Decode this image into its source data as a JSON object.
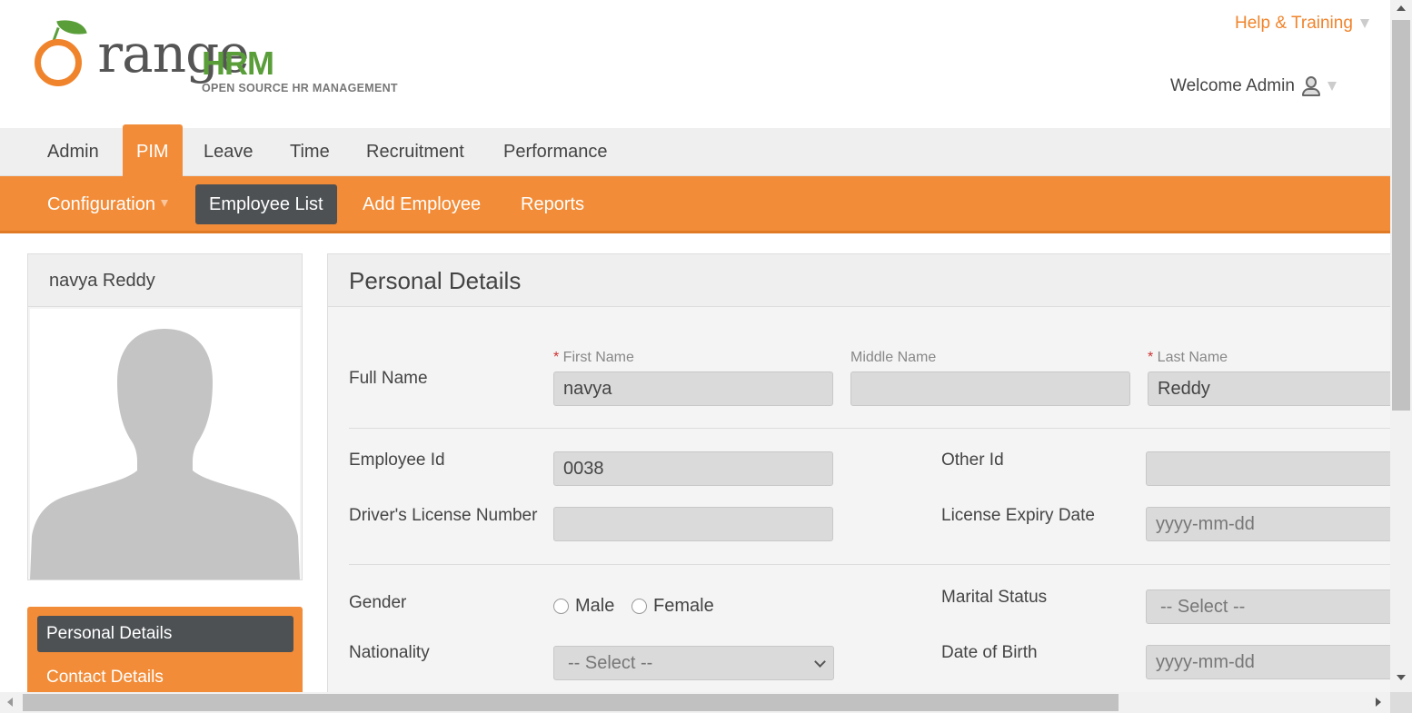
{
  "header": {
    "logo_text": "Orange",
    "logo_hrm": "HRM",
    "logo_tagline": "OPEN SOURCE HR MANAGEMENT",
    "help_label": "Help & Training",
    "welcome_label": "Welcome Admin"
  },
  "mainnav": {
    "items": [
      {
        "label": "Admin"
      },
      {
        "label": "PIM",
        "active": true
      },
      {
        "label": "Leave"
      },
      {
        "label": "Time"
      },
      {
        "label": "Recruitment"
      },
      {
        "label": "Performance"
      }
    ]
  },
  "subnav": {
    "items": [
      {
        "label": "Configuration"
      },
      {
        "label": "Employee List",
        "active": true
      },
      {
        "label": "Add Employee"
      },
      {
        "label": "Reports"
      }
    ]
  },
  "profile": {
    "name": "navya Reddy"
  },
  "sidemenu": {
    "items": [
      {
        "label": "Personal Details",
        "active": true
      },
      {
        "label": "Contact Details"
      }
    ]
  },
  "personal_details": {
    "title": "Personal Details",
    "full_name_label": "Full Name",
    "first_name_label": "First Name",
    "middle_name_label": "Middle Name",
    "last_name_label": "Last Name",
    "first_name_value": "navya",
    "middle_name_value": "",
    "last_name_value": "Reddy",
    "employee_id_label": "Employee Id",
    "employee_id_value": "0038",
    "other_id_label": "Other Id",
    "other_id_value": "",
    "drivers_license_label": "Driver's License Number",
    "drivers_license_value": "",
    "license_expiry_label": "License Expiry Date",
    "license_expiry_placeholder": "yyyy-mm-dd",
    "gender_label": "Gender",
    "gender_male": "Male",
    "gender_female": "Female",
    "marital_status_label": "Marital Status",
    "marital_status_value": "-- Select --",
    "nationality_label": "Nationality",
    "nationality_value": "-- Select --",
    "dob_label": "Date of Birth",
    "dob_placeholder": "yyyy-mm-dd"
  },
  "colors": {
    "brand_orange": "#f28c38",
    "active_dark": "#4d5154",
    "logo_green": "#5a9e3a"
  }
}
